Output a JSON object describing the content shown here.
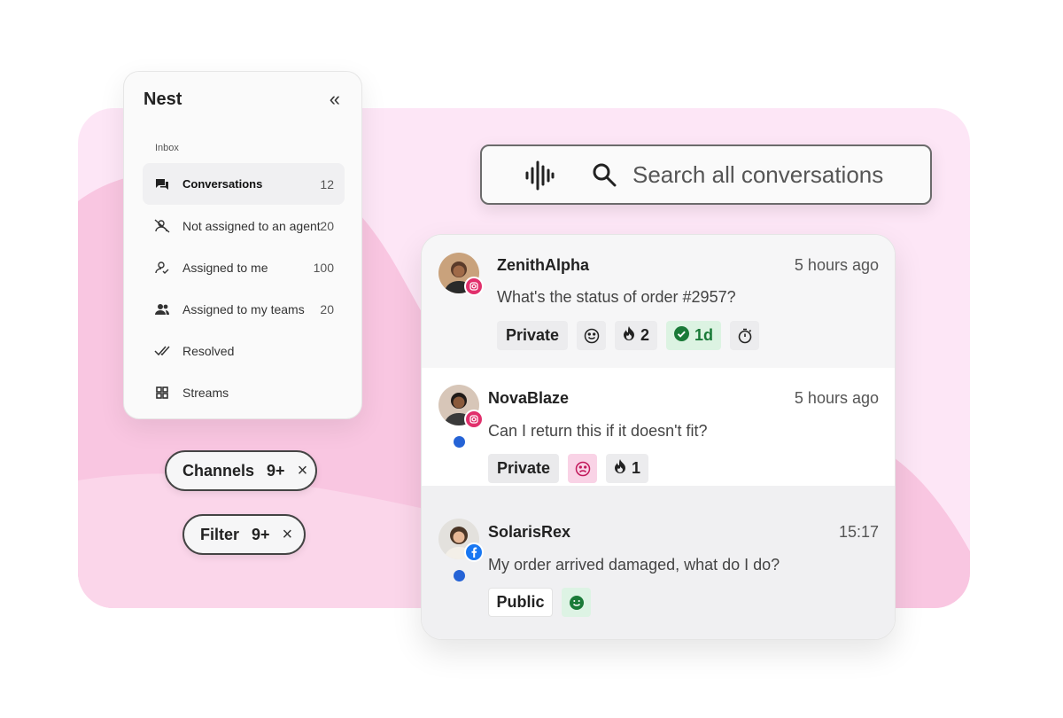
{
  "colors": {
    "background_pink": "#fde6f6",
    "accent_pink": "#f7c4e0",
    "unread_blue": "#2563d6",
    "instagram": "#e1306c",
    "facebook": "#1877f2",
    "resolved_green": "#1a7a38"
  },
  "sidebar": {
    "title": "Nest",
    "collapse_icon": "double-chevron-left-icon",
    "section_label": "Inbox",
    "items": [
      {
        "label": "Conversations",
        "count": "12",
        "icon": "chat-bubbles-icon",
        "active": true
      },
      {
        "label": "Not assigned to an agent",
        "count": "20",
        "icon": "user-off-icon"
      },
      {
        "label": "Assigned to me",
        "count": "100",
        "icon": "user-check-icon"
      },
      {
        "label": "Assigned to my teams",
        "count": "20",
        "icon": "team-icon"
      },
      {
        "label": "Resolved",
        "count": "",
        "icon": "double-check-icon"
      },
      {
        "label": "Streams",
        "count": "",
        "icon": "grid-icon"
      }
    ]
  },
  "filters": [
    {
      "label": "Channels",
      "count": "9+",
      "remove": "×"
    },
    {
      "label": "Filter",
      "count": "9+",
      "remove": "×"
    }
  ],
  "search": {
    "placeholder": "Search all conversations",
    "voice_icon": "voice-wave-icon",
    "search_icon": "search-icon"
  },
  "conversations": [
    {
      "name": "ZenithAlpha",
      "time": "5 hours ago",
      "message": "What's the status of order #2957?",
      "channel": "instagram",
      "unread": false,
      "tags": {
        "visibility": "Private",
        "priority_count": "2",
        "sla": "1d"
      },
      "icons": [
        "smile-icon",
        "fire-icon",
        "check-circle-icon",
        "timer-icon"
      ]
    },
    {
      "name": "NovaBlaze",
      "time": "5 hours ago",
      "message": "Can I return this if it doesn't fit?",
      "channel": "instagram",
      "unread": true,
      "tags": {
        "visibility": "Private",
        "priority_count": "1"
      },
      "icons": [
        "sad-face-icon",
        "fire-icon"
      ]
    },
    {
      "name": "SolarisRex",
      "time": "15:17",
      "message": "My order arrived damaged, what do I do?",
      "channel": "facebook",
      "unread": true,
      "tags": {
        "visibility": "Public"
      },
      "icons": [
        "happy-face-icon"
      ]
    }
  ]
}
